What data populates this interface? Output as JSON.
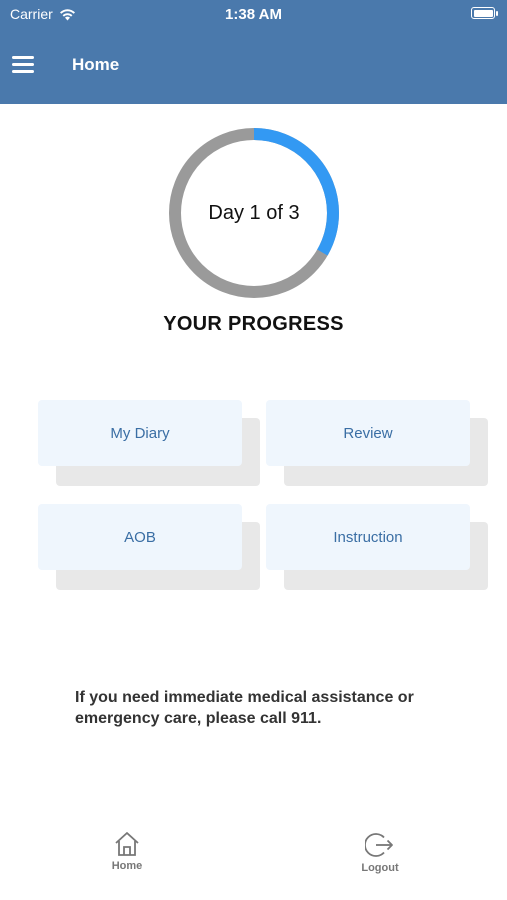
{
  "status_bar": {
    "carrier": "Carrier",
    "time": "1:38 AM"
  },
  "nav": {
    "title": "Home"
  },
  "progress": {
    "label": "Day 1 of 3",
    "current_day": 1,
    "total_days": 3,
    "heading": "YOUR PROGRESS"
  },
  "colors": {
    "accent": "#4a79ac",
    "ring_fill": "#3399f3",
    "ring_track": "#9a9a9a",
    "tile_bg": "#eff6fd",
    "tile_text": "#3a6ea4"
  },
  "tiles": [
    {
      "label": "My Diary"
    },
    {
      "label": "Review"
    },
    {
      "label": "AOB"
    },
    {
      "label": "Instruction"
    }
  ],
  "notice": "If you need immediate medical assistance or emergency care, please call 911.",
  "tabs": [
    {
      "label": "Home",
      "icon": "home-icon"
    },
    {
      "label": "Logout",
      "icon": "logout-icon"
    }
  ]
}
